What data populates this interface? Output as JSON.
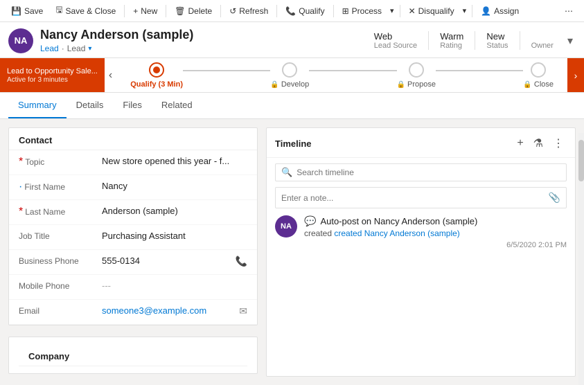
{
  "toolbar": {
    "save_label": "Save",
    "save_close_label": "Save & Close",
    "new_label": "New",
    "delete_label": "Delete",
    "refresh_label": "Refresh",
    "qualify_label": "Qualify",
    "process_label": "Process",
    "disqualify_label": "Disqualify",
    "assign_label": "Assign",
    "more_icon": "⋯"
  },
  "header": {
    "avatar_initials": "NA",
    "title": "Nancy Anderson (sample)",
    "subtitle_part1": "Lead",
    "subtitle_separator": "·",
    "subtitle_part2": "Lead",
    "fields": [
      {
        "label": "Lead Source",
        "value": "Web"
      },
      {
        "label": "Rating",
        "value": "Warm"
      },
      {
        "label": "Status",
        "value": "New"
      },
      {
        "label": "Owner",
        "value": ""
      }
    ]
  },
  "stage_bar": {
    "promo_title": "Lead to Opportunity Sale...",
    "promo_subtitle": "Active for 3 minutes",
    "steps": [
      {
        "label": "Qualify",
        "sublabel": "(3 Min)",
        "state": "active",
        "locked": false
      },
      {
        "label": "Develop",
        "state": "normal",
        "locked": true
      },
      {
        "label": "Propose",
        "state": "normal",
        "locked": true
      },
      {
        "label": "Close",
        "state": "normal",
        "locked": true
      }
    ]
  },
  "tabs": [
    {
      "label": "Summary",
      "active": true
    },
    {
      "label": "Details",
      "active": false
    },
    {
      "label": "Files",
      "active": false
    },
    {
      "label": "Related",
      "active": false
    }
  ],
  "contact": {
    "section_title": "Contact",
    "fields": [
      {
        "label": "Topic",
        "required": true,
        "value": "New store opened this year - f...",
        "action": null
      },
      {
        "label": "First Name",
        "optional": true,
        "value": "Nancy",
        "action": null
      },
      {
        "label": "Last Name",
        "required": true,
        "value": "Anderson (sample)",
        "action": null
      },
      {
        "label": "Job Title",
        "required": false,
        "value": "Purchasing Assistant",
        "action": null
      },
      {
        "label": "Business Phone",
        "required": false,
        "value": "555-0134",
        "action": "phone"
      },
      {
        "label": "Mobile Phone",
        "required": false,
        "value": "---",
        "action": null
      },
      {
        "label": "Email",
        "required": false,
        "value": "someone3@example.com",
        "action": "email"
      }
    ]
  },
  "company": {
    "section_title": "Company"
  },
  "timeline": {
    "title": "Timeline",
    "search_placeholder": "Search timeline",
    "note_placeholder": "Enter a note...",
    "entries": [
      {
        "avatar_initials": "NA",
        "icon": "💬",
        "title": "Auto-post on Nancy Anderson (sample)",
        "sub": "created Nancy Anderson (sample)",
        "timestamp": "6/5/2020 2:01 PM"
      }
    ]
  }
}
